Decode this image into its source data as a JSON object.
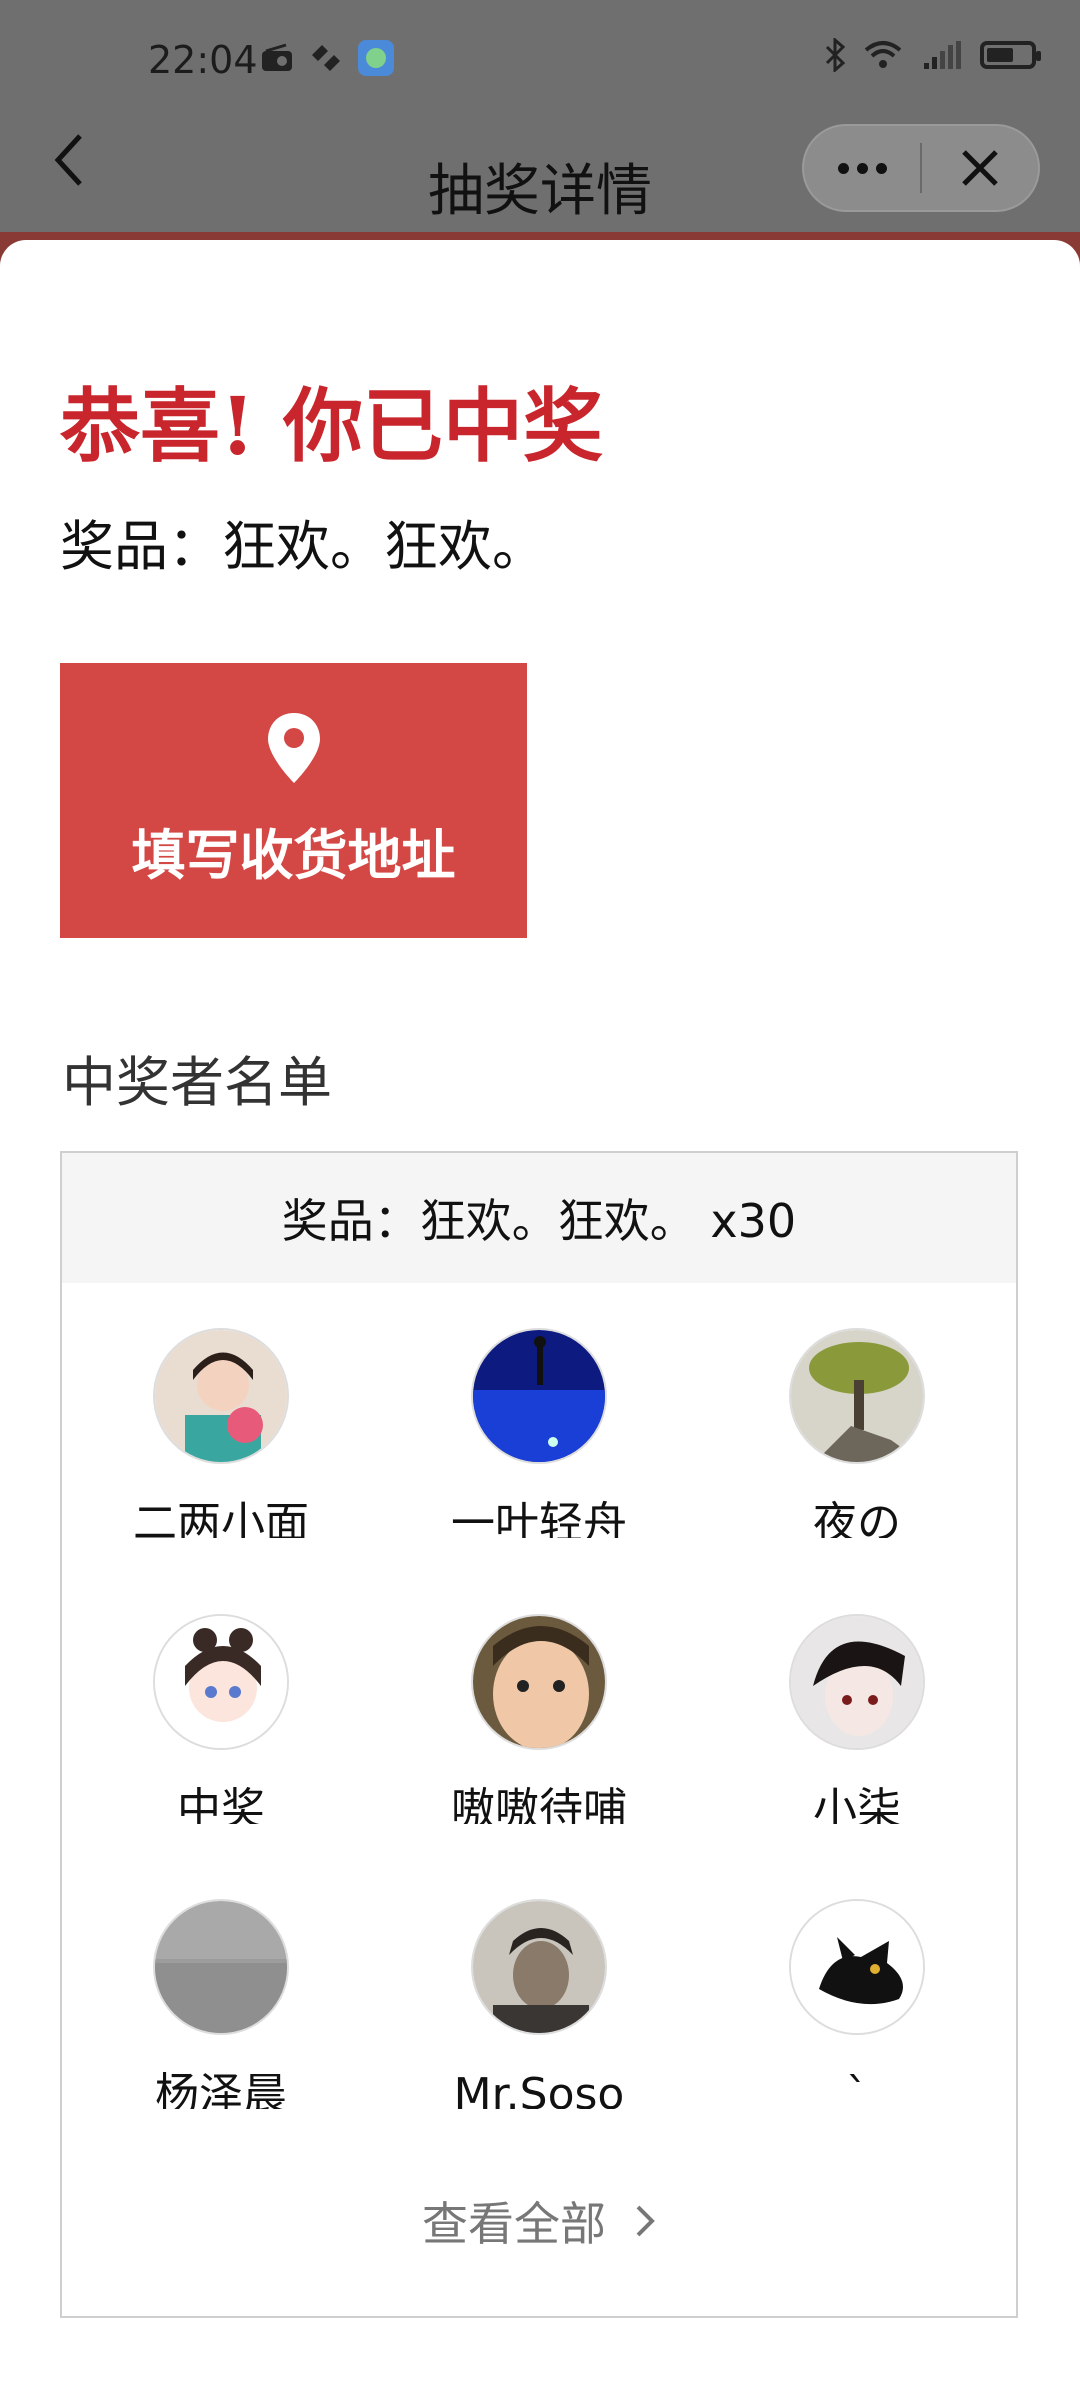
{
  "status_bar": {
    "time": "22:04"
  },
  "nav": {
    "title": "抽奖详情"
  },
  "result": {
    "headline": "恭喜! 你已中奖",
    "prize_line": "奖品：狂欢。狂欢。"
  },
  "address_button": {
    "label": "填写收货地址"
  },
  "winners": {
    "section_title": "中奖者名单",
    "header": "奖品：狂欢。狂欢。 x30",
    "list": [
      {
        "name": "二两小面"
      },
      {
        "name": "一叶轻舟"
      },
      {
        "name": "夜の"
      },
      {
        "name": "中奖"
      },
      {
        "name": "嗷嗷待哺"
      },
      {
        "name": "小柒"
      },
      {
        "name": "杨泽晨"
      },
      {
        "name": "Mr.Soso"
      },
      {
        "name": "`"
      }
    ],
    "view_all": "查看全部"
  },
  "colors": {
    "accent_red": "#c8262c",
    "button_red": "#d34744"
  }
}
